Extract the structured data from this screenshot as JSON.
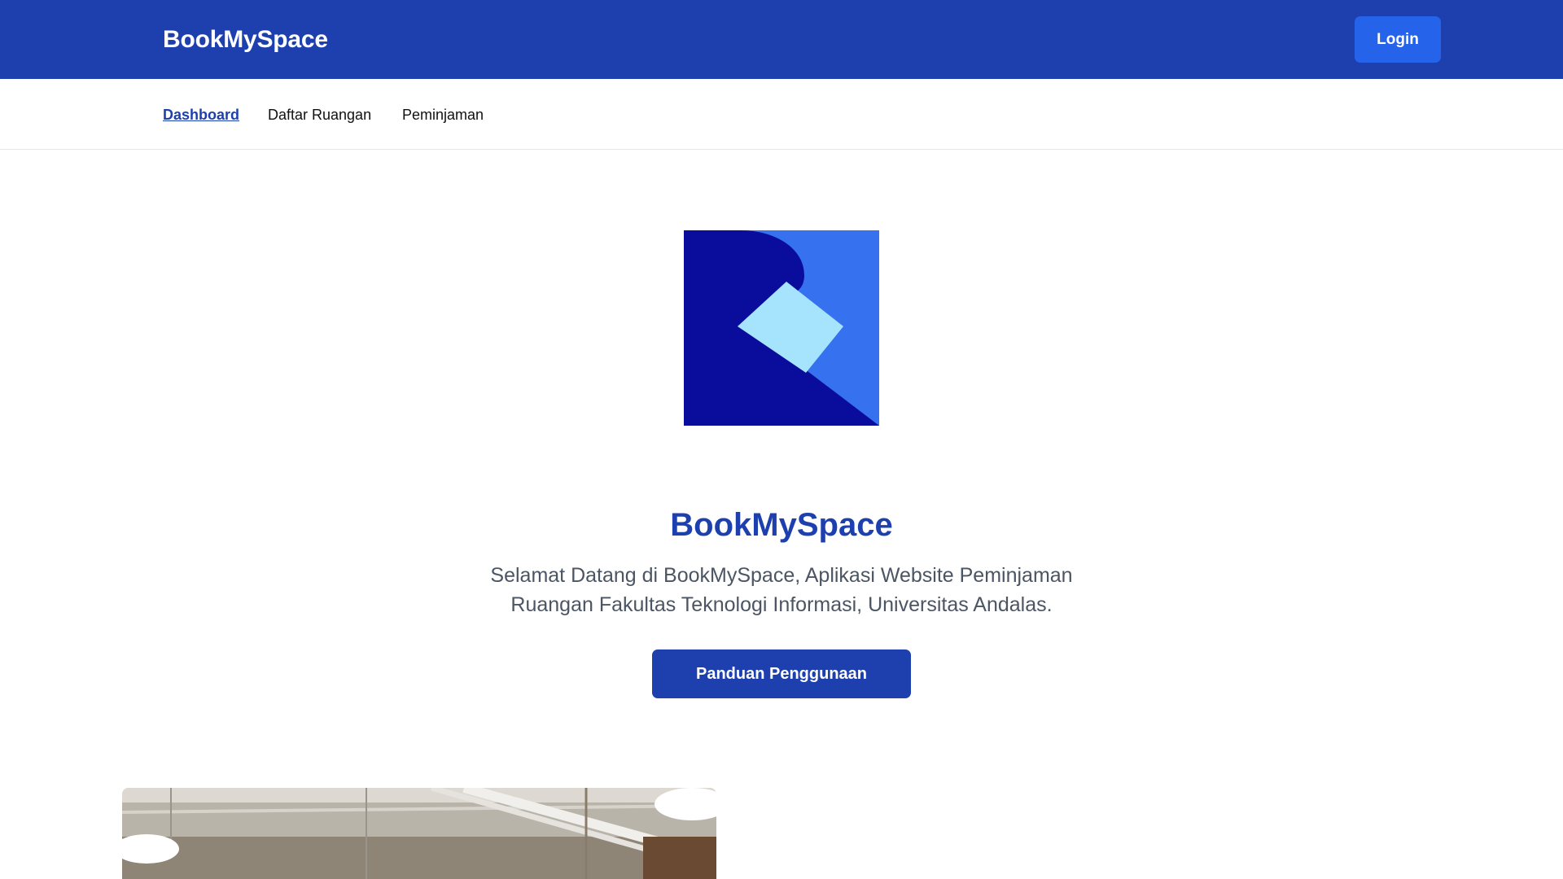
{
  "header": {
    "brand": "BookMySpace",
    "login_label": "Login"
  },
  "nav": {
    "items": [
      {
        "label": "Dashboard",
        "active": true
      },
      {
        "label": "Daftar Ruangan",
        "active": false
      },
      {
        "label": "Peminjaman",
        "active": false
      }
    ]
  },
  "hero": {
    "logo_icon": "bookmyspace-logo",
    "title": "BookMySpace",
    "description": "Selamat Datang di BookMySpace, Aplikasi Website Peminjaman Ruangan Fakultas Teknologi Informasi, Universitas Andalas.",
    "button_label": "Panduan Penggunaan"
  },
  "colors": {
    "primary": "#1e40af",
    "accent": "#2563eb",
    "logo_dark": "#0a0c9c",
    "logo_mid": "#3672ef",
    "logo_light": "#a6e4fd"
  }
}
